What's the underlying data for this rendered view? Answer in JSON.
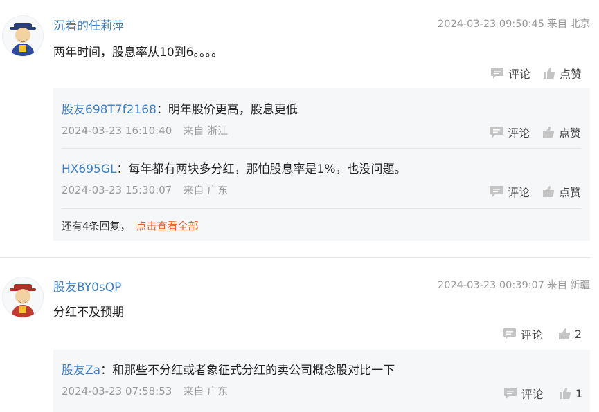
{
  "posts": [
    {
      "username": "沉着的任莉萍",
      "datetime": "2024-03-23 09:50:45",
      "from_label": "来自",
      "location": "北京",
      "content": "两年时间，股息率从10到6。。。。",
      "comment_label": "评论",
      "like_label": "点赞",
      "avatar_icon": "caishen-avatar-icon",
      "replies": [
        {
          "username": "股友698T7f2168",
          "text": "：明年股价更高，股息更低",
          "datetime": "2024-03-23 16:10:40",
          "from": "来自 浙江",
          "comment_label": "评论",
          "like_label": "点赞"
        },
        {
          "username": "HX695GL",
          "text": "：每年都有两块多分红，那怕股息率是1%，也没问题。",
          "datetime": "2024-03-23 15:30:07",
          "from": "来自 广东",
          "comment_label": "评论",
          "like_label": "点赞"
        }
      ],
      "more_text": "还有4条回复，",
      "more_link": "点击查看全部"
    },
    {
      "username": "股友BY0sQP",
      "datetime": "2024-03-23 00:39:07",
      "from_label": "来自",
      "location": "新疆",
      "content": "分红不及预期",
      "comment_label": "评论",
      "like_count": "2",
      "avatar_icon": "caishen-avatar-icon",
      "replies": [
        {
          "username": "股友Za",
          "text": "：和那些不分红或者象征式分红的卖公司概念股对比一下",
          "datetime": "2024-03-23 07:58:53",
          "from": "来自 广东",
          "comment_label": "评论",
          "like_count": "1"
        }
      ]
    }
  ],
  "colors": {
    "username": "#3d7fc4",
    "meta": "#999999",
    "link": "#e0602a",
    "reply_bg": "#f6f7f9",
    "icon": "#c4c4c4"
  }
}
